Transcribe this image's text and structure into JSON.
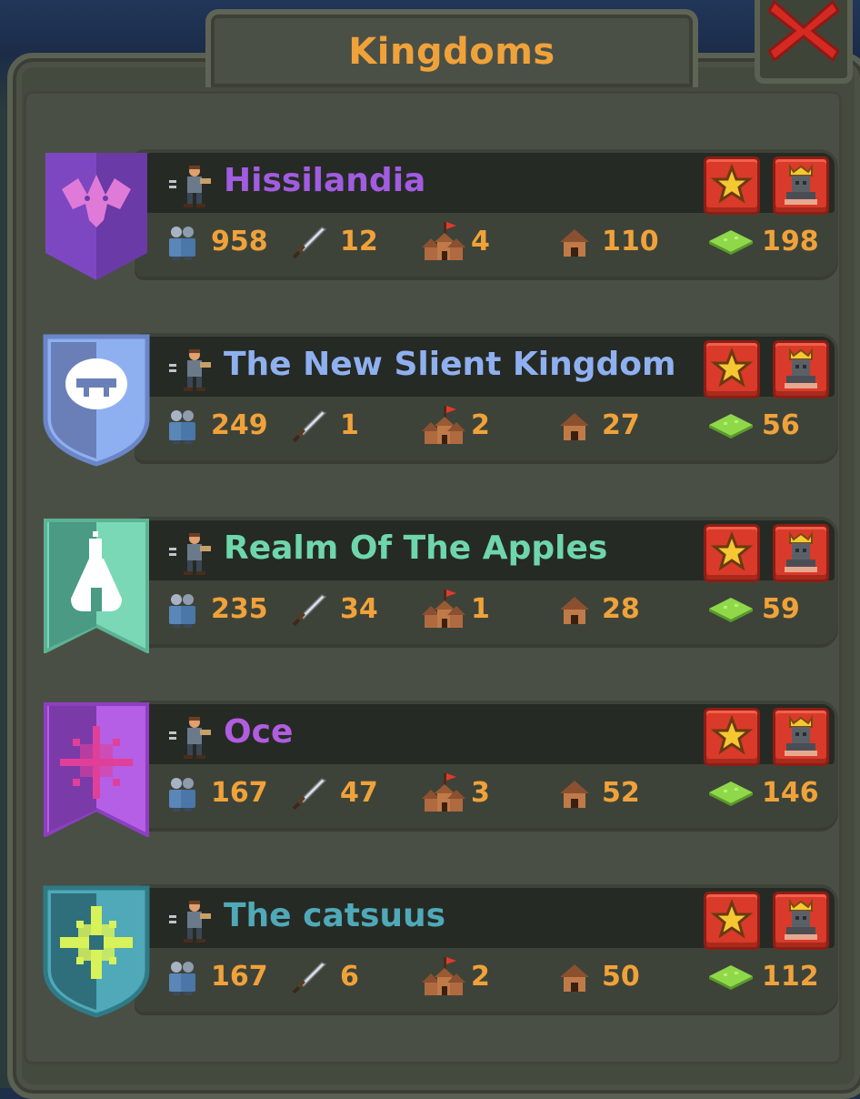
{
  "window": {
    "title": "Kingdoms"
  },
  "colors": {
    "accent": "#f0a23a",
    "button_red": "#d93a2a",
    "panel": "#454a3f"
  },
  "icons": {
    "population": "people-icon",
    "army": "sword-icon",
    "cities": "city-flag-icon",
    "houses": "house-icon",
    "territory": "grass-tile-icon",
    "favorite": "star-icon",
    "king": "king-portrait-icon",
    "leader": "leader-figure-icon",
    "close": "close-x-icon"
  },
  "kingdoms": [
    {
      "name": "Hissilandia",
      "color": "#a15ce0",
      "banner": "purple-bat-banner",
      "population": "958",
      "army": "12",
      "cities": "4",
      "houses": "110",
      "territory": "198"
    },
    {
      "name": "The New Slient Kingdom",
      "color": "#8fb0f0",
      "banner": "blue-shield-banner",
      "population": "249",
      "army": "1",
      "cities": "2",
      "houses": "27",
      "territory": "56"
    },
    {
      "name": "Realm Of The Apples",
      "color": "#6fd6ac",
      "banner": "teal-flask-banner",
      "population": "235",
      "army": "34",
      "cities": "1",
      "houses": "28",
      "territory": "59"
    },
    {
      "name": "Oce",
      "color": "#b05de0",
      "banner": "violet-star-banner",
      "population": "167",
      "army": "47",
      "cities": "3",
      "houses": "52",
      "territory": "146"
    },
    {
      "name": "The catsuus",
      "color": "#4fa9b8",
      "banner": "teal-cross-shield",
      "population": "167",
      "army": "6",
      "cities": "2",
      "houses": "50",
      "territory": "112"
    }
  ]
}
